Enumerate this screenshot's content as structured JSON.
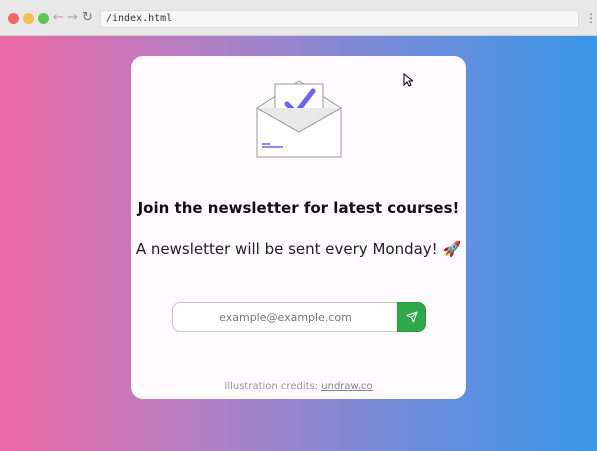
{
  "browser": {
    "address": "/index.html",
    "back_icon": "arrow-left-icon",
    "forward_icon": "arrow-right-icon",
    "reload_icon": "reload-icon",
    "menu_icon": "kebab-menu-icon"
  },
  "colors": {
    "gradient_start": "#ee6aa7",
    "gradient_end": "#3a96e6",
    "card_bg": "#fdfbfd",
    "submit_green": "#2fa84a",
    "check_purple": "#6c63ff"
  },
  "card": {
    "illustration_icon": "envelope-checkmark-icon",
    "title": "Join the newsletter for latest courses!",
    "subtitle": "A newsletter will be sent every Monday! 🚀",
    "email_placeholder": "example@example.com",
    "submit_icon": "send-icon",
    "credits_prefix": "Illustration credits: ",
    "credits_link": "undraw.co"
  }
}
